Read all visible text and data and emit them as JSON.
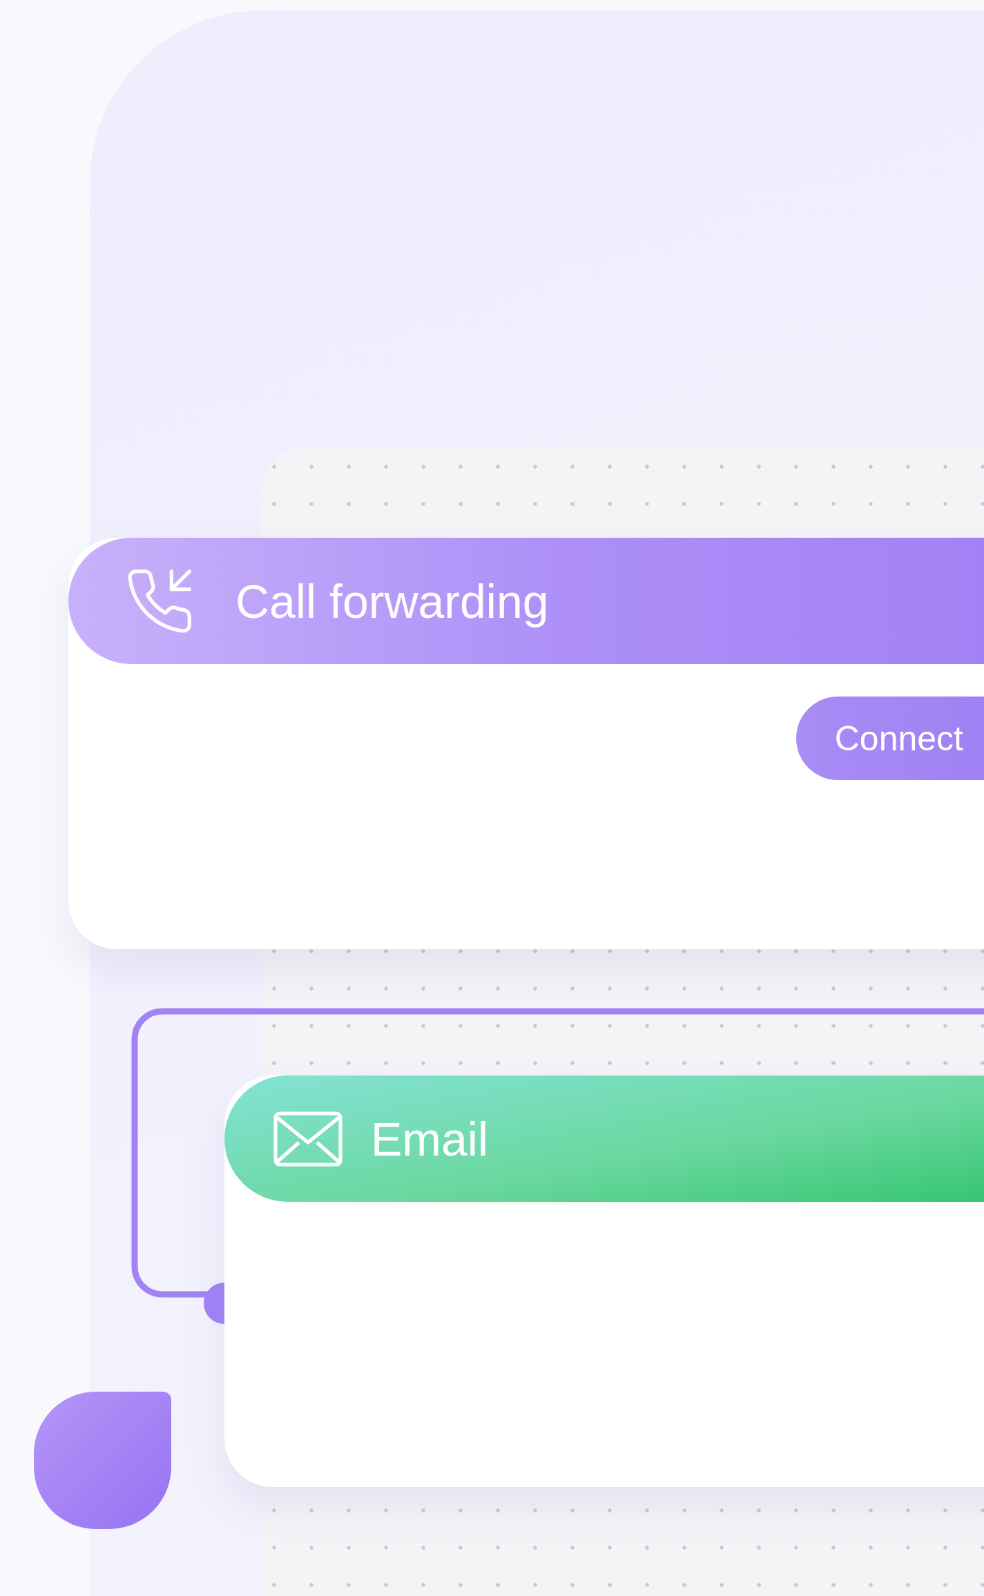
{
  "cards": [
    {
      "kind": "call",
      "title": "Call forwarding",
      "button": "Connect"
    },
    {
      "kind": "email",
      "title": "Email"
    }
  ]
}
